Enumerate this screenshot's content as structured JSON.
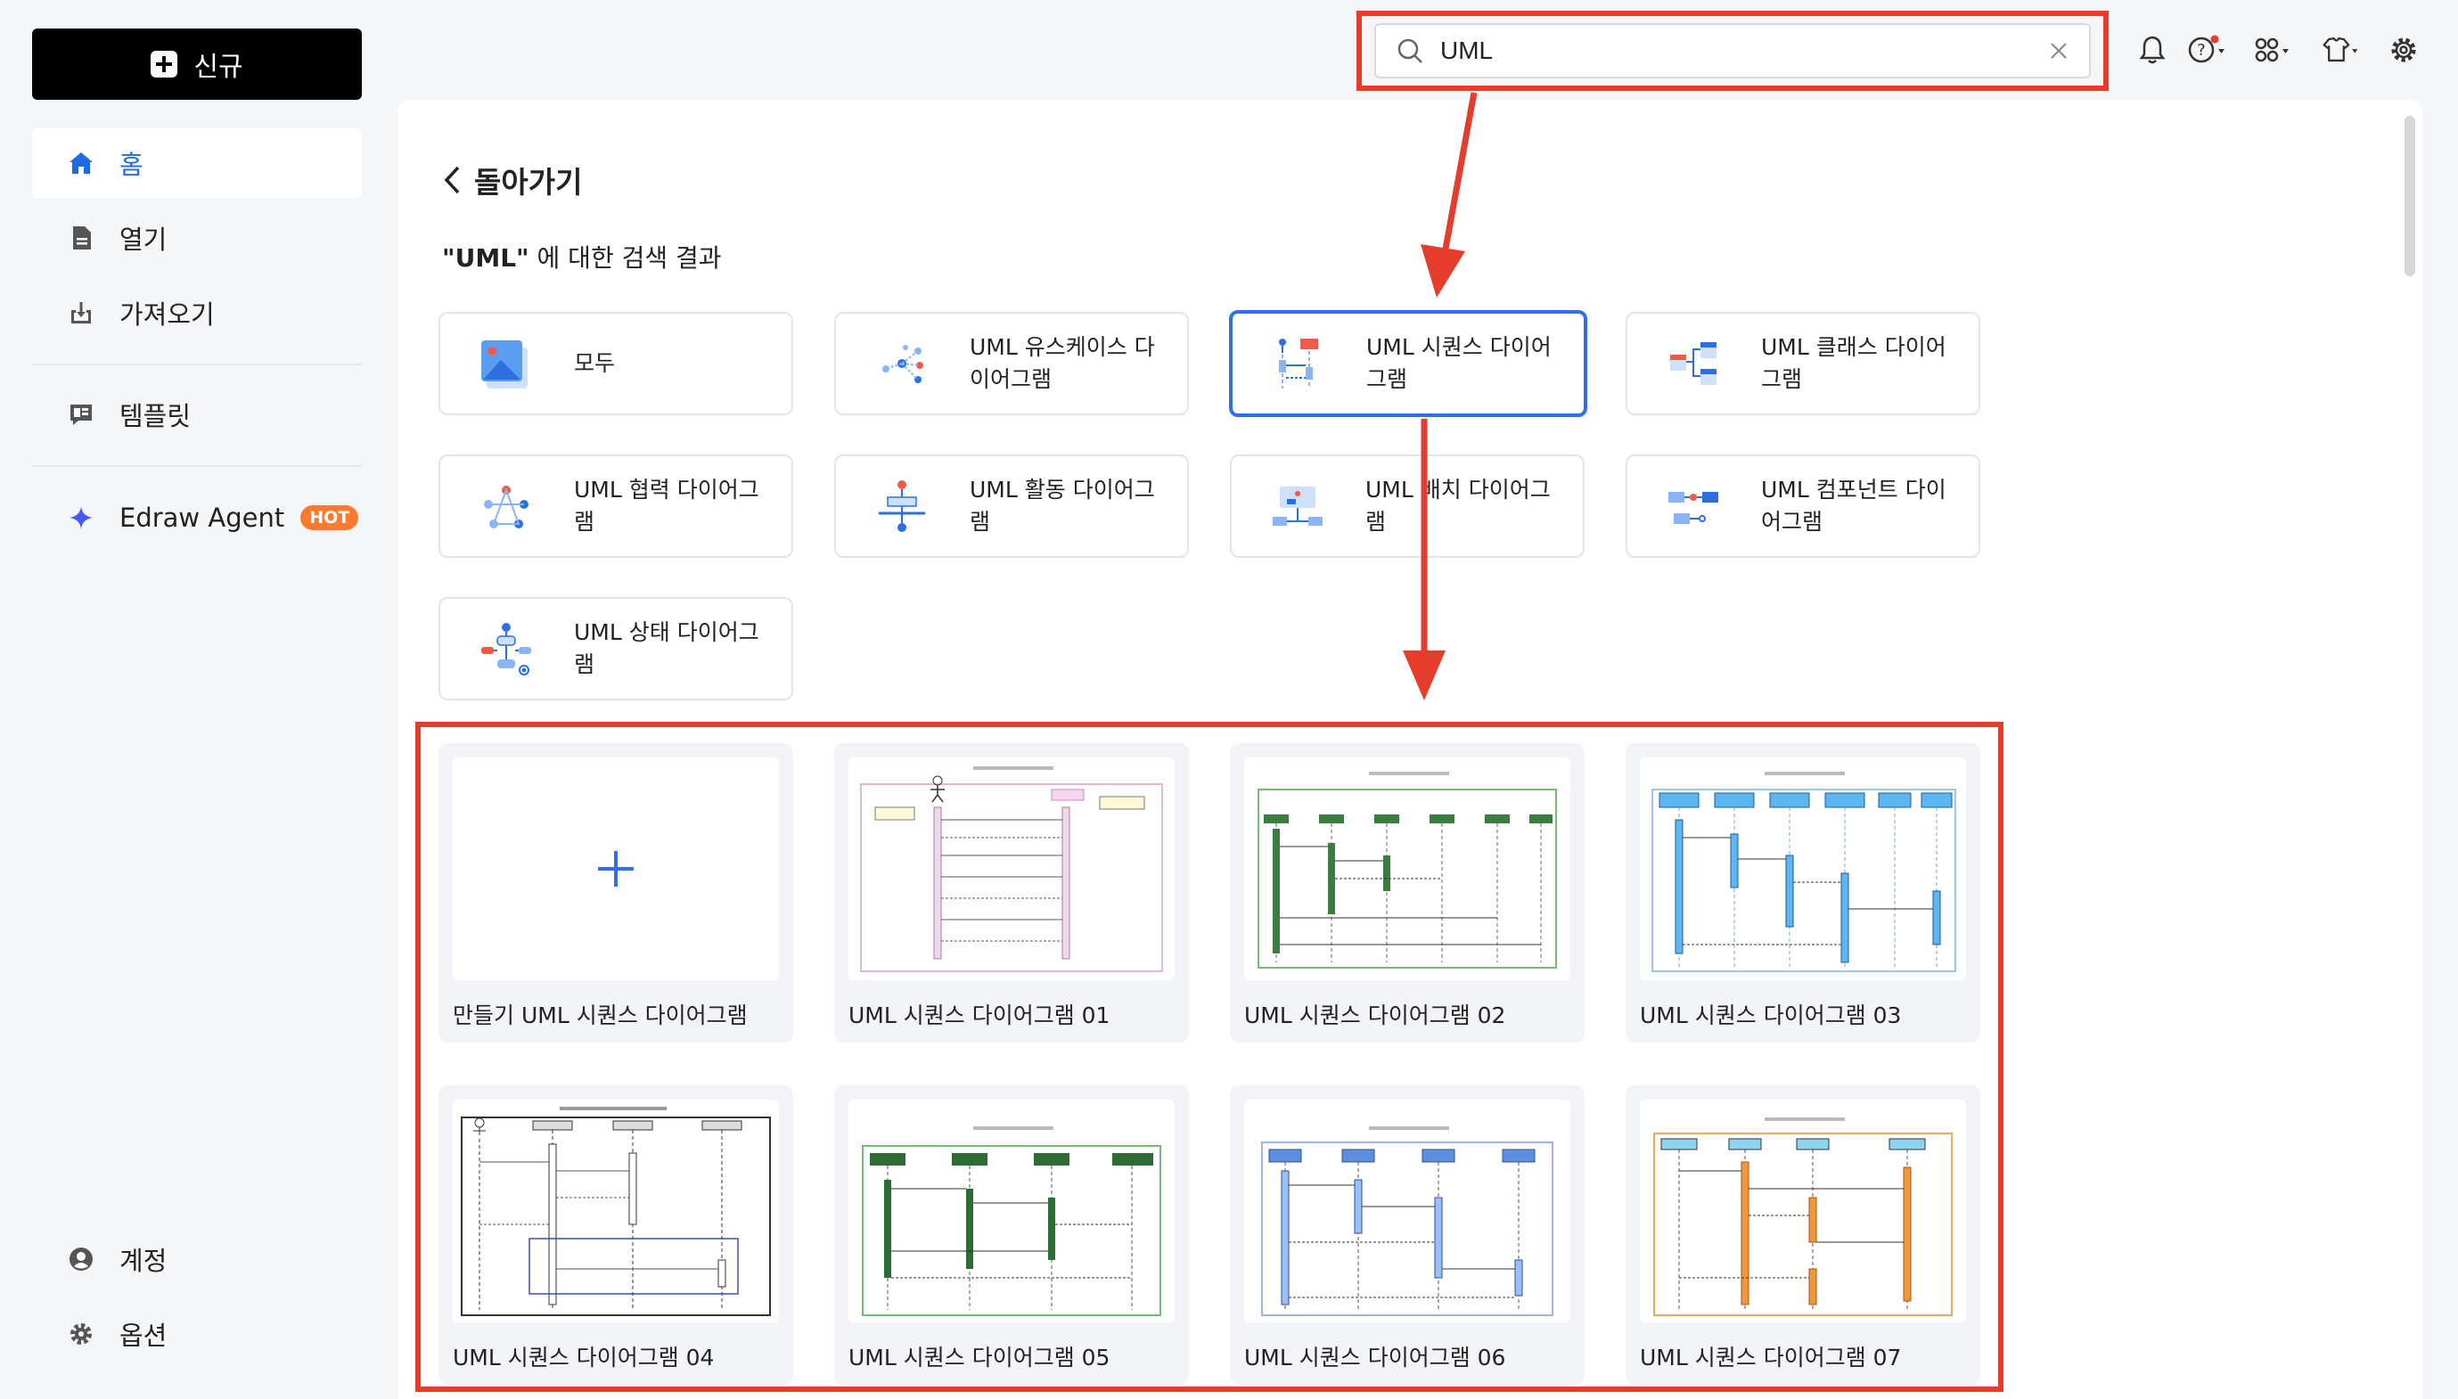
{
  "sidebar": {
    "new_label": "신규",
    "items": [
      {
        "label": "홈",
        "icon": "home-icon"
      },
      {
        "label": "열기",
        "icon": "document-icon"
      },
      {
        "label": "가져오기",
        "icon": "import-icon"
      },
      {
        "label": "템플릿",
        "icon": "template-icon"
      },
      {
        "label": "Edraw Agent",
        "icon": "sparkle-icon",
        "badge": "HOT"
      }
    ],
    "bottom": [
      {
        "label": "계정",
        "icon": "account-icon"
      },
      {
        "label": "옵션",
        "icon": "gear-icon"
      }
    ]
  },
  "search": {
    "value": "UML"
  },
  "main": {
    "back_label": "돌아가기",
    "results_query": "\"UML\"",
    "results_suffix": " 에 대한 검색 결과",
    "categories": [
      {
        "label": "모두"
      },
      {
        "label": "UML 유스케이스 다이어그램"
      },
      {
        "label": "UML 시퀀스 다이어그램"
      },
      {
        "label": "UML 클래스 다이어그램"
      },
      {
        "label": "UML 협력 다이어그램"
      },
      {
        "label": "UML 활동 다이어그램"
      },
      {
        "label": "UML 배치 다이어그램"
      },
      {
        "label": "UML 컴포넌트 다이어그램"
      },
      {
        "label": "UML 상태 다이어그램"
      }
    ],
    "templates": [
      {
        "label": "만들기 UML 시퀀스 다이어그램"
      },
      {
        "label": "UML 시퀀스 다이어그램 01"
      },
      {
        "label": "UML 시퀀스 다이어그램 02"
      },
      {
        "label": "UML 시퀀스 다이어그램 03"
      },
      {
        "label": "UML 시퀀스 다이어그램 04"
      },
      {
        "label": "UML 시퀀스 다이어그램 05"
      },
      {
        "label": "UML 시퀀스 다이어그램 06"
      },
      {
        "label": "UML 시퀀스 다이어그램 07"
      }
    ]
  },
  "colors": {
    "accent": "#1e6be6",
    "highlight": "#e63c2b",
    "hot_badge": "#ff7a2e"
  }
}
